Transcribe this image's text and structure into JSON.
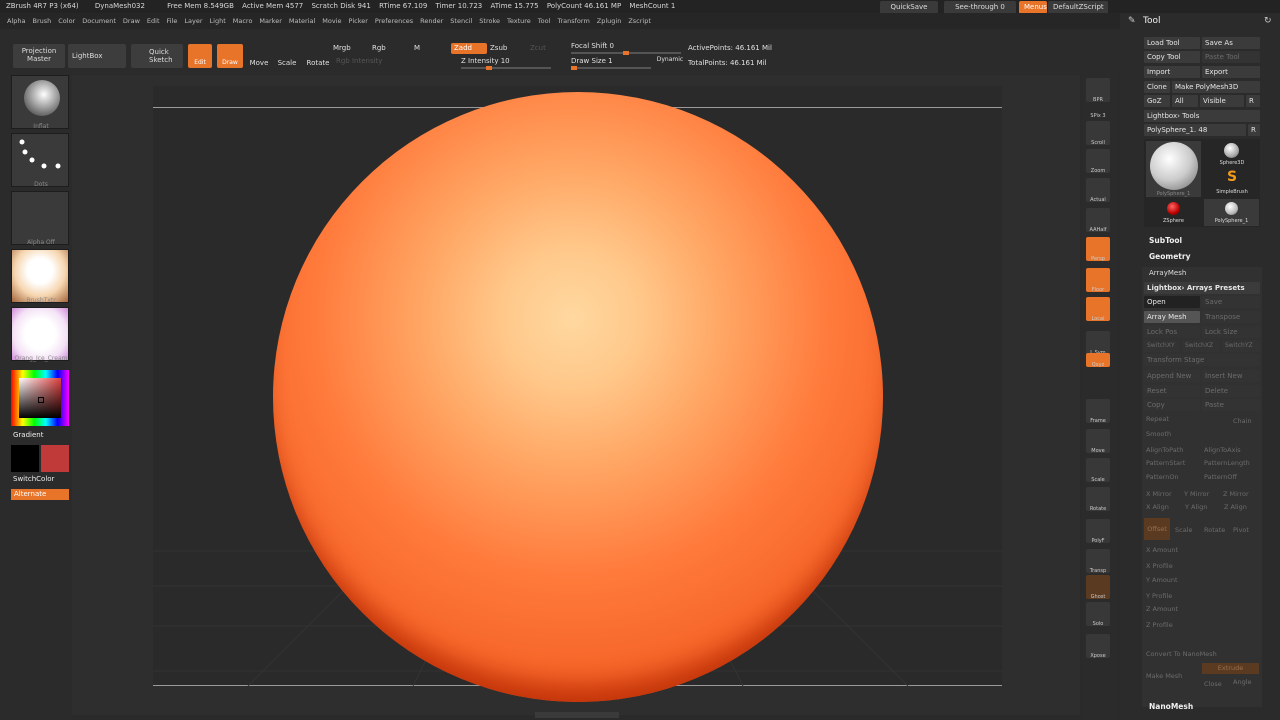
{
  "titlebar": {
    "app": "ZBrush 4R7 P3 (x64)",
    "doc": "DynaMesh032",
    "free_mem": "Free Mem 8.549GB",
    "active_mem": "Active Mem 4577",
    "scratch": "Scratch Disk 941",
    "rtime": "RTime 67.109",
    "timer": "Timer 10.723",
    "atime": "ATime 15.775",
    "polycount": "PolyCount 46.161 MP",
    "meshcount": "MeshCount 1",
    "quicksave": "QuickSave",
    "seethrough": "See-through 0",
    "menus": "Menus",
    "defaultscript": "DefaultZScript"
  },
  "menu": [
    "Alpha",
    "Brush",
    "Color",
    "Document",
    "Draw",
    "Edit",
    "File",
    "Layer",
    "Light",
    "Macro",
    "Marker",
    "Material",
    "Movie",
    "Picker",
    "Preferences",
    "Render",
    "Stencil",
    "Stroke",
    "Texture",
    "Tool",
    "Transform",
    "Zplugin",
    "Zscript"
  ],
  "toolbar": {
    "projection_master": "Projection Master",
    "lightbox": "LightBox",
    "quick_sketch": "Quick Sketch",
    "edit": "Edit",
    "draw": "Draw",
    "move": "Move",
    "scale": "Scale",
    "rotate": "Rotate",
    "mrgb": "Mrgb",
    "rgb": "Rgb",
    "m": "M",
    "rgb_intensity": "Rgb Intensity",
    "zadd": "Zadd",
    "zsub": "Zsub",
    "zcut": "Zcut",
    "z_intensity": "Z Intensity 10",
    "focal_shift": "Focal Shift 0",
    "draw_size": "Draw Size 1",
    "dynamic": "Dynamic",
    "active_points": "ActivePoints: 46.161  Mil",
    "total_points": "TotalPoints: 46.161  Mil"
  },
  "left": {
    "brush_label": "Inflat",
    "stroke_label": "Dots",
    "alpha_label": "Alpha Off",
    "texture_label": "BrushTxtr",
    "material_label": "Orang_Ice_Cream",
    "gradient": "Gradient",
    "switchcolor": "SwitchColor",
    "alternate": "Alternate"
  },
  "right_shelf": [
    "BPR",
    "SPix 3",
    "Scroll",
    "Zoom",
    "Actual",
    "AAHalf",
    "Persp",
    "Floor",
    "Local",
    "L.Sym",
    "Qxyz",
    "",
    "",
    "Frame",
    "Move",
    "Scale",
    "Rotate",
    "PolyF",
    "Transp",
    "Ghost",
    "Solo",
    "Xpose"
  ],
  "panel": {
    "title": "Tool",
    "load_tool": "Load Tool",
    "save_as": "Save As",
    "copy_tool": "Copy Tool",
    "paste_tool": "Paste Tool",
    "import": "Import",
    "export": "Export",
    "clone": "Clone",
    "make_polymesh": "Make PolyMesh3D",
    "goz": "GoZ",
    "all": "All",
    "visible": "Visible",
    "r": "R",
    "lightbox_tools": "Lightbox› Tools",
    "current_tool": "PolySphere_1. 48",
    "tools": [
      "PolySphere_1",
      "Sphere3D",
      "SimpleBrush",
      "ZSphere",
      "PolySphere_1"
    ],
    "subtool": "SubTool",
    "geometry": "Geometry",
    "arraymesh": "ArrayMesh",
    "lightbox_arrays": "Lightbox› Arrays Presets",
    "open": "Open",
    "save": "Save",
    "array_mesh": "Array Mesh",
    "transpose": "Transpose",
    "lock_pos": "Lock Pos",
    "lock_size": "Lock Size",
    "switchxy": "SwitchXY",
    "switchxz": "SwitchXZ",
    "switchyz": "SwitchYZ",
    "transform_stage": "Transform Stage",
    "append_new": "Append New",
    "insert_new": "Insert New",
    "reset": "Reset",
    "delete": "Delete",
    "copy": "Copy",
    "paste": "Paste",
    "repeat": "Repeat",
    "chain": "Chain",
    "smooth": "Smooth",
    "aligntopath": "AlignToPath",
    "aligntoaxis": "AlignToAxis",
    "patternstart": "PatternStart",
    "patternlength": "PatternLength",
    "patternon": "PatternOn",
    "patternoff": "PatternOff",
    "x_mirror": "X Mirror",
    "y_mirror": "Y Mirror",
    "z_mirror": "Z Mirror",
    "x_align": "X Align",
    "y_align": "Y Align",
    "z_align": "Z Align",
    "offset": "Offset",
    "scale": "Scale",
    "rotate": "Rotate",
    "pivot": "Pivot",
    "x_amount": "X Amount",
    "x_profile": "X Profile",
    "y_amount": "Y Amount",
    "y_profile": "Y Profile",
    "z_amount": "Z Amount",
    "z_profile": "Z Profile",
    "convert_nanomesh": "Convert To NanoMesh",
    "make_mesh": "Make Mesh",
    "extrude": "Extrude",
    "close": "Close",
    "angle": "Angle",
    "nanomesh": "NanoMesh"
  },
  "colors": {
    "accent": "#e8742a",
    "sphere_light": "#ffd49a",
    "sphere_mid": "#ff7a3c",
    "sphere_dark": "#d8420e"
  }
}
